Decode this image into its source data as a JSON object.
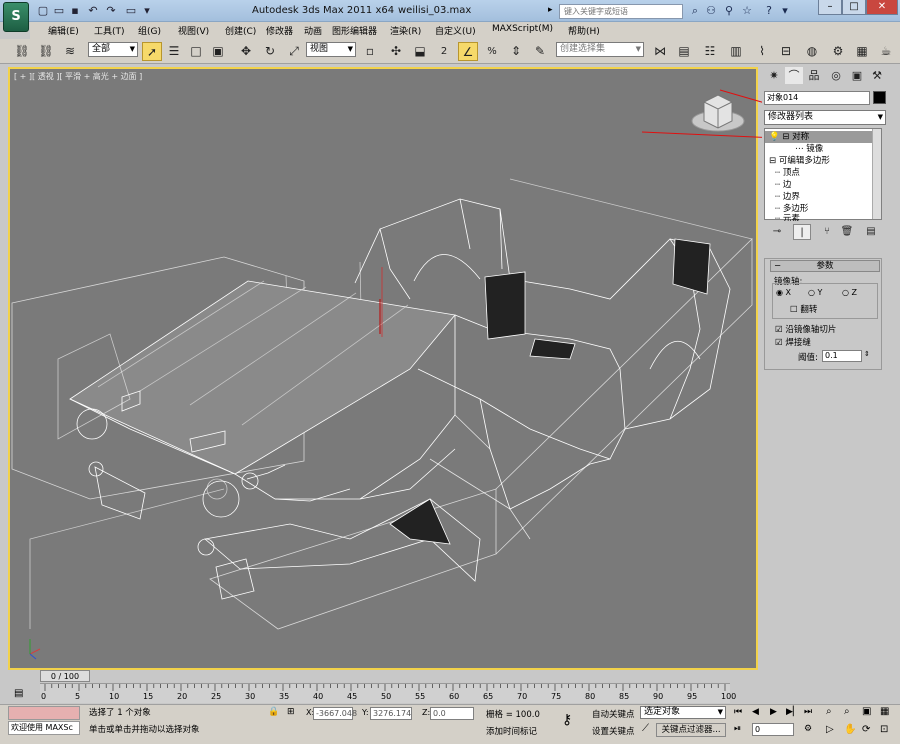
{
  "titlebar": {
    "app_title": "Autodesk 3ds Max  2011 x64",
    "filename": "weilisi_03.max",
    "search_placeholder": "键入关键字或短语"
  },
  "menu": [
    "编辑(E)",
    "工具(T)",
    "组(G)",
    "视图(V)",
    "创建(C)",
    "修改器",
    "动画",
    "图形编辑器",
    "渲染(R)",
    "自定义(U)",
    "MAXScript(M)",
    "帮助(H)"
  ],
  "toolbar": {
    "selection_filter": "全部",
    "ref_coord": "视图",
    "num2": "2",
    "numpct": "%",
    "named_selection_placeholder": "创建选择集"
  },
  "viewport": {
    "label": "[ + ][ 透视 ][ 平滑 + 高光 + 边面 ]",
    "frame_counter": "0 / 100"
  },
  "cmdpanel": {
    "object_name": "对象014",
    "modifier_list": "修改器列表",
    "stack": [
      "对称",
      "镜像",
      "可编辑多边形",
      "顶点",
      "边",
      "边界",
      "多边形",
      "元素"
    ],
    "rollout_title": "参数",
    "mirror_axis_label": "镜像轴:",
    "axes": [
      "X",
      "Y",
      "Z"
    ],
    "flip_label": "翻转",
    "slice_label": "沿镜像轴切片",
    "weld_label": "焊接缝",
    "threshold_label": "阈值:",
    "threshold_value": "0.1"
  },
  "timeline": {
    "ticks": [
      "0",
      "5",
      "10",
      "15",
      "20",
      "25",
      "30",
      "35",
      "40",
      "45",
      "50",
      "55",
      "60",
      "65",
      "70",
      "75",
      "80",
      "85",
      "90",
      "95",
      "100"
    ]
  },
  "status": {
    "maxscript": "欢迎使用 MAXSc",
    "selection_info": "选择了 1 个对象",
    "prompt": "单击或单击并拖动以选择对象",
    "x_label": "X:",
    "x_value": "-3667.048",
    "y_label": "Y:",
    "y_value": "3276.174",
    "z_label": "Z:",
    "z_value": "0.0",
    "grid": "栅格 = 100.0",
    "add_time_tag": "添加时间标记",
    "auto_key": "自动关键点",
    "set_key": "设置关键点",
    "selected_dropdown": "选定对象",
    "key_filters": "关键点过滤器...",
    "frame_value": "0"
  },
  "colors": {
    "viewport_bg": "#7a7a7a",
    "active_border": "#f2d24a",
    "ui_gray": "#c8c8c8"
  }
}
